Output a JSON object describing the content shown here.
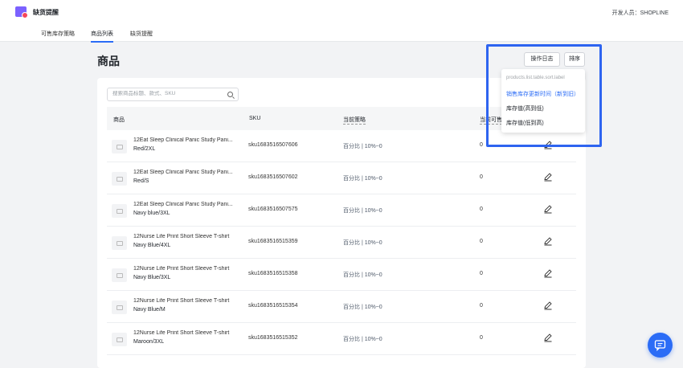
{
  "app": {
    "title": "缺货提醒",
    "user_label": "开发人员：SHOPLINE"
  },
  "tabs": [
    {
      "label": "可售库存策略"
    },
    {
      "label": "商品列表"
    },
    {
      "label": "缺货提醒"
    }
  ],
  "page": {
    "title": "商品"
  },
  "toolbar": {
    "log_label": "操作日志",
    "sort_label": "排序"
  },
  "search": {
    "placeholder": "搜索商品标题、款式、SKU",
    "value": ""
  },
  "table": {
    "headers": [
      "商品",
      "SKU",
      "当前策略",
      "当前可售"
    ],
    "rows": [
      {
        "name": "12Eat Sleep Clinical Panic Study Pani...",
        "variant": "Red/2XL",
        "sku": "sku1683516507606",
        "strategy": "百分比 | 10%~0",
        "stock": "0"
      },
      {
        "name": "12Eat Sleep Clinical Panic Study Pani...",
        "variant": "Red/S",
        "sku": "sku1683516507602",
        "strategy": "百分比 | 10%~0",
        "stock": "0"
      },
      {
        "name": "12Eat Sleep Clinical Panic Study Pani...",
        "variant": "Navy blue/3XL",
        "sku": "sku1683516507575",
        "strategy": "百分比 | 10%~0",
        "stock": "0"
      },
      {
        "name": "12Nurse Life Print Short Sleeve T-shirt",
        "variant": "Navy Blue/4XL",
        "sku": "sku1683516515359",
        "strategy": "百分比 | 10%~0",
        "stock": "0"
      },
      {
        "name": "12Nurse Life Print Short Sleeve T-shirt",
        "variant": "Navy Blue/3XL",
        "sku": "sku1683516515358",
        "strategy": "百分比 | 10%~0",
        "stock": "0"
      },
      {
        "name": "12Nurse Life Print Short Sleeve T-shirt",
        "variant": "Navy Blue/M",
        "sku": "sku1683516515354",
        "strategy": "百分比 | 10%~0",
        "stock": "0"
      },
      {
        "name": "12Nurse Life Print Short Sleeve T-shirt",
        "variant": "Maroon/3XL",
        "sku": "sku1683516515352",
        "strategy": "百分比 | 10%~0",
        "stock": "0"
      }
    ],
    "first_row_stock": "0"
  },
  "sort_menu": {
    "label": "products.list.table.sort.label",
    "items": [
      {
        "label": "销售库存更新时间（新到旧）",
        "selected": true
      },
      {
        "label": "库存值(高到低)",
        "selected": false
      },
      {
        "label": "库存值(低到高)",
        "selected": false
      }
    ]
  },
  "colors": {
    "accent": "#2b6cf6",
    "logo": "#7b61ff",
    "highlight": "#2e64f0"
  },
  "icons": {
    "search": "search-icon",
    "edit": "edit-icon",
    "chat": "chat-icon"
  }
}
